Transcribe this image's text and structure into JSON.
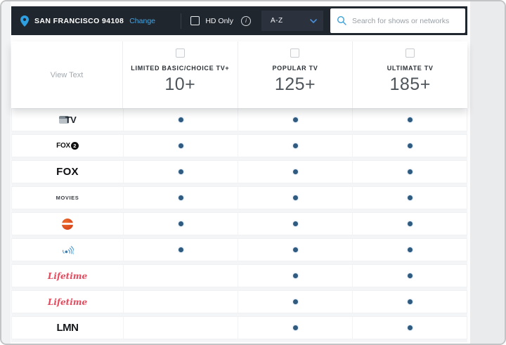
{
  "top_bar": {
    "location": "SAN FRANCISCO 94108",
    "change_label": "Change",
    "hd_only_label": "HD Only",
    "sort_selected": "A-Z",
    "search_placeholder": "Search for shows or networks"
  },
  "table_header": {
    "view_text_label": "View Text",
    "packages": [
      {
        "name": "LIMITED BASIC/CHOICE TV+",
        "channel_count": "10+"
      },
      {
        "name": "POPULAR TV",
        "channel_count": "125+"
      },
      {
        "name": "ULTIMATE TV",
        "channel_count": "185+"
      }
    ]
  },
  "channels": [
    {
      "name": "TV",
      "logo_type": "tv-tile",
      "logo_text": "TV",
      "included": [
        true,
        true,
        true
      ]
    },
    {
      "name": "FOX 2",
      "logo_type": "fox2",
      "logo_text": "FOX",
      "logo_badge": "2",
      "included": [
        true,
        true,
        true
      ]
    },
    {
      "name": "FOX",
      "logo_type": "fox",
      "logo_text": "FOX",
      "included": [
        true,
        true,
        true
      ]
    },
    {
      "name": "MOVIES",
      "logo_type": "movies",
      "logo_text": "MOVIES",
      "included": [
        true,
        true,
        true
      ]
    },
    {
      "name": "orange circle network",
      "logo_type": "orange-circle",
      "logo_text": "",
      "included": [
        true,
        true,
        true
      ]
    },
    {
      "name": "signal network",
      "logo_type": "signal",
      "logo_text": "",
      "included": [
        true,
        true,
        true
      ]
    },
    {
      "name": "Lifetime",
      "logo_type": "lifetime",
      "logo_text": "Lifetime",
      "included": [
        false,
        true,
        true
      ]
    },
    {
      "name": "Lifetime",
      "logo_type": "lifetime",
      "logo_text": "Lifetime",
      "included": [
        false,
        true,
        true
      ]
    },
    {
      "name": "LMN",
      "logo_type": "lmn",
      "logo_text": "LMN",
      "included": [
        false,
        true,
        true
      ]
    }
  ],
  "colors": {
    "accent_blue": "#3aa0d8",
    "dot": "#2f5b80",
    "top_bar_bg": "#20262e",
    "lifetime_red": "#e8495d"
  }
}
